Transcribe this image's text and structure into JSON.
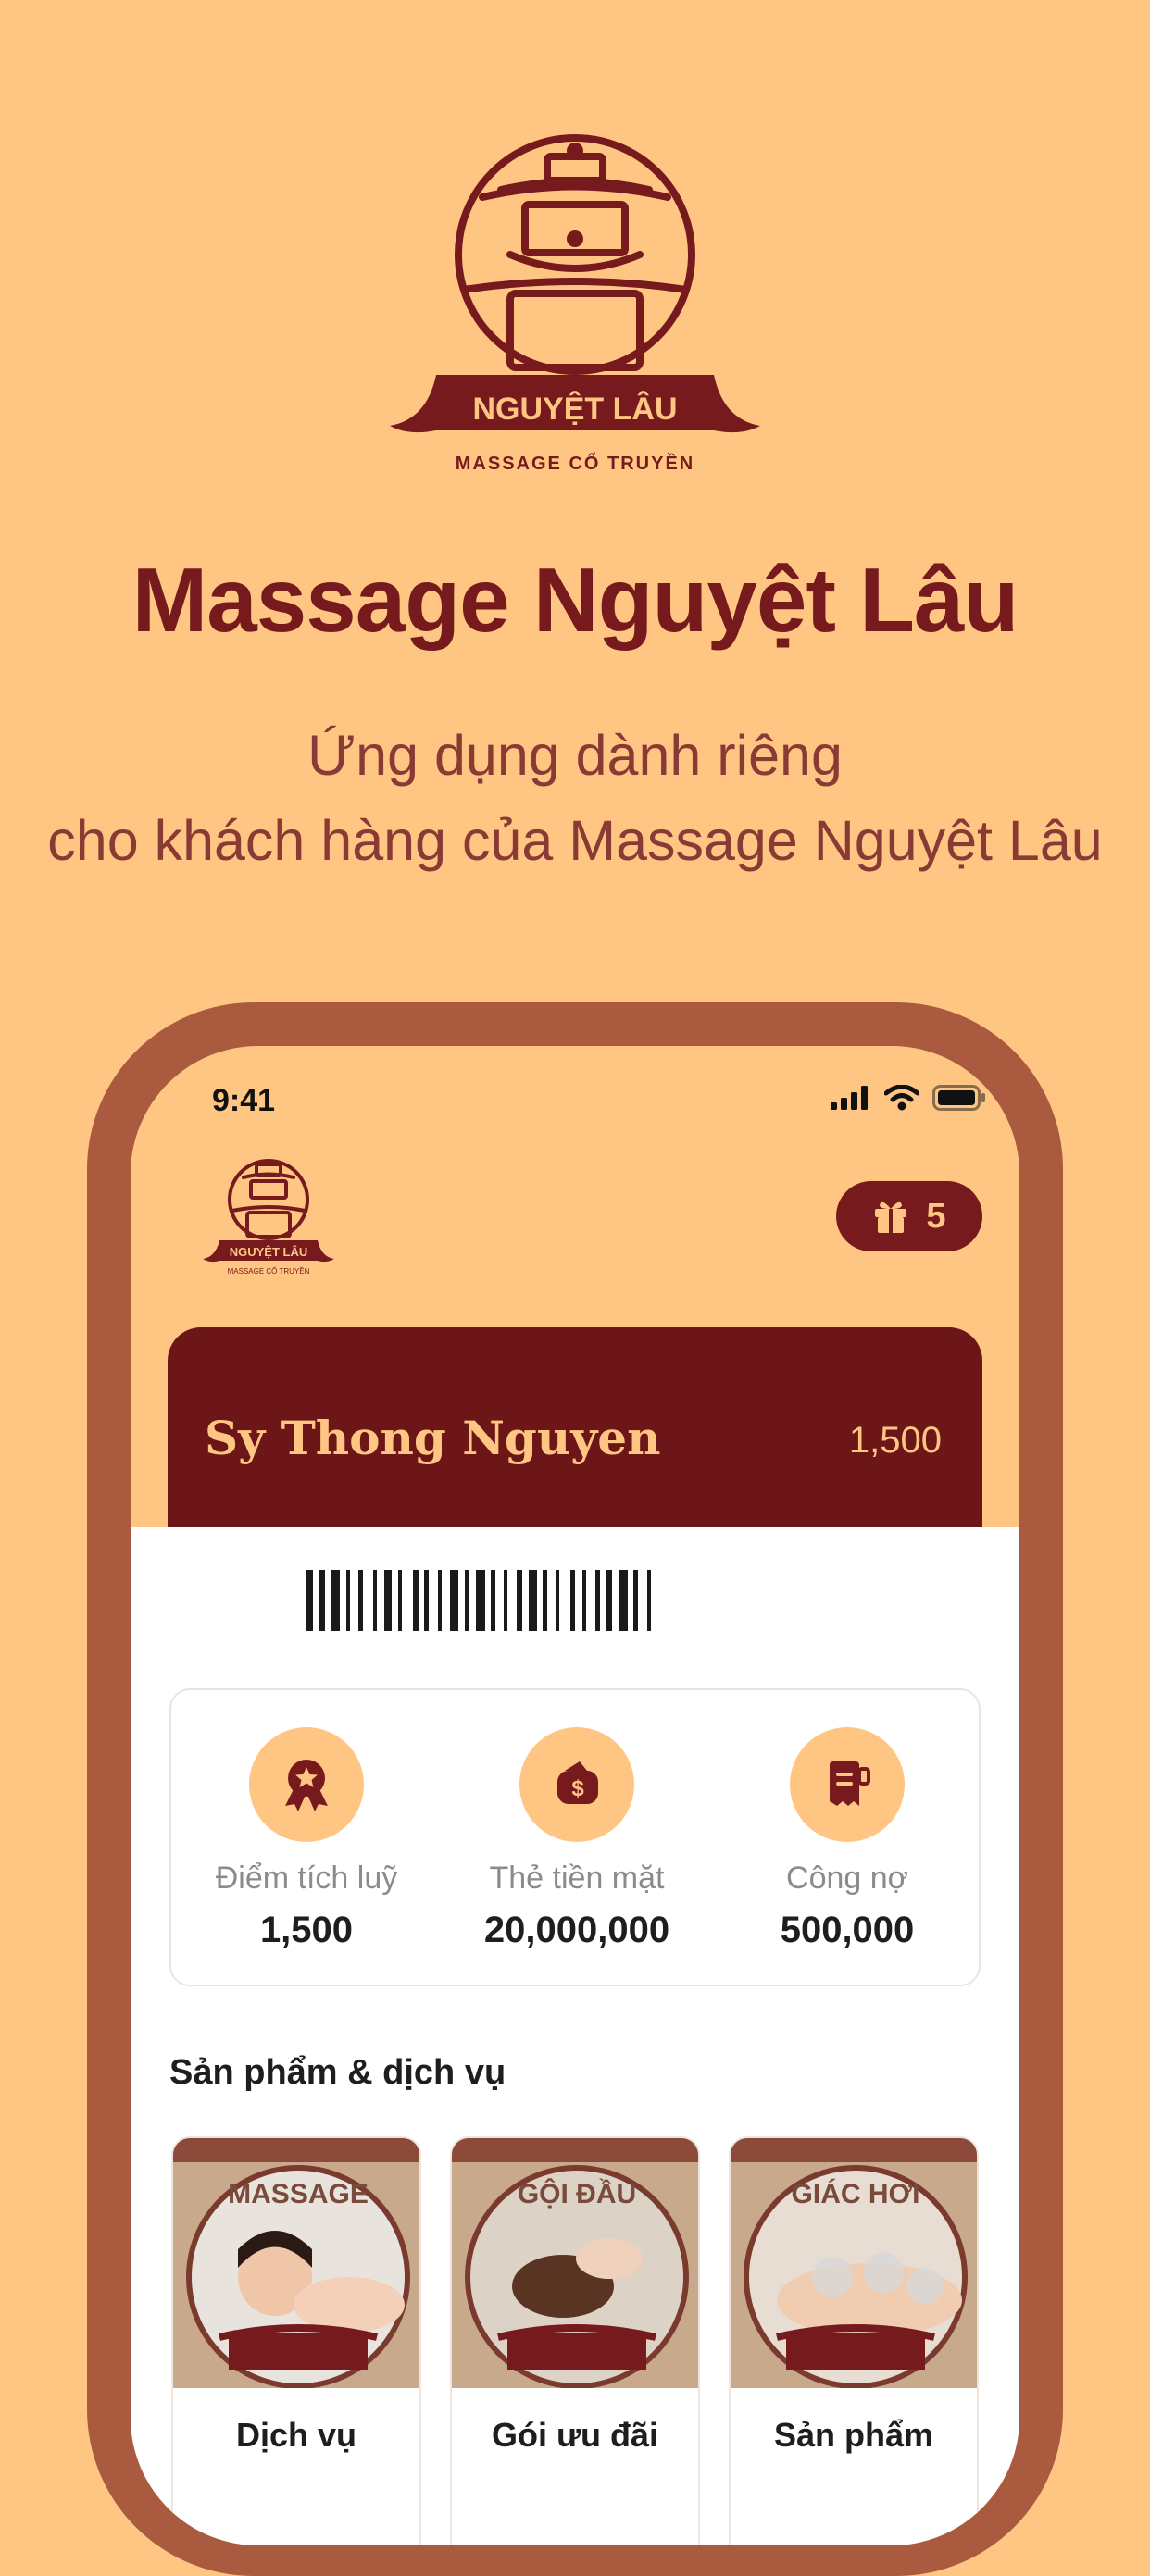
{
  "brand": {
    "logo_name": "NGUYỆT LÂU",
    "logo_sub": "MASSAGE CỔ TRUYỀN"
  },
  "headline": "Massage Nguyệt Lâu",
  "tagline": {
    "line1": "Ứng dụng dành riêng",
    "line2": "cho khách hàng của Massage Nguyệt Lâu"
  },
  "status_bar": {
    "time": "9:41",
    "icons": [
      "signal-icon",
      "wifi-icon",
      "battery-icon"
    ]
  },
  "gift": {
    "icon": "gift-icon",
    "count": "5"
  },
  "member": {
    "name": "Sy Thong Nguyen",
    "points": "1,500"
  },
  "stats": [
    {
      "icon": "award-medal-icon",
      "label": "Điểm tích luỹ",
      "value": "1,500"
    },
    {
      "icon": "wallet-dollar-icon",
      "label": "Thẻ tiền mặt",
      "value": "20,000,000"
    },
    {
      "icon": "receipt-icon",
      "label": "Công nợ",
      "value": "500,000"
    }
  ],
  "products": {
    "title": "Sản phẩm & dịch vụ",
    "items": [
      {
        "banner": "MASSAGE",
        "caption": "Dịch vụ"
      },
      {
        "banner": "GỘI ĐẦU",
        "caption": "Gói ưu đãi"
      },
      {
        "banner": "GIÁC HƠI",
        "caption": "Sản phẩm"
      }
    ]
  },
  "colors": {
    "background": "#FFC683",
    "brand_dark_red": "#761A1D",
    "frame_brown": "#A95A3F",
    "card_red": "#6D1618"
  }
}
